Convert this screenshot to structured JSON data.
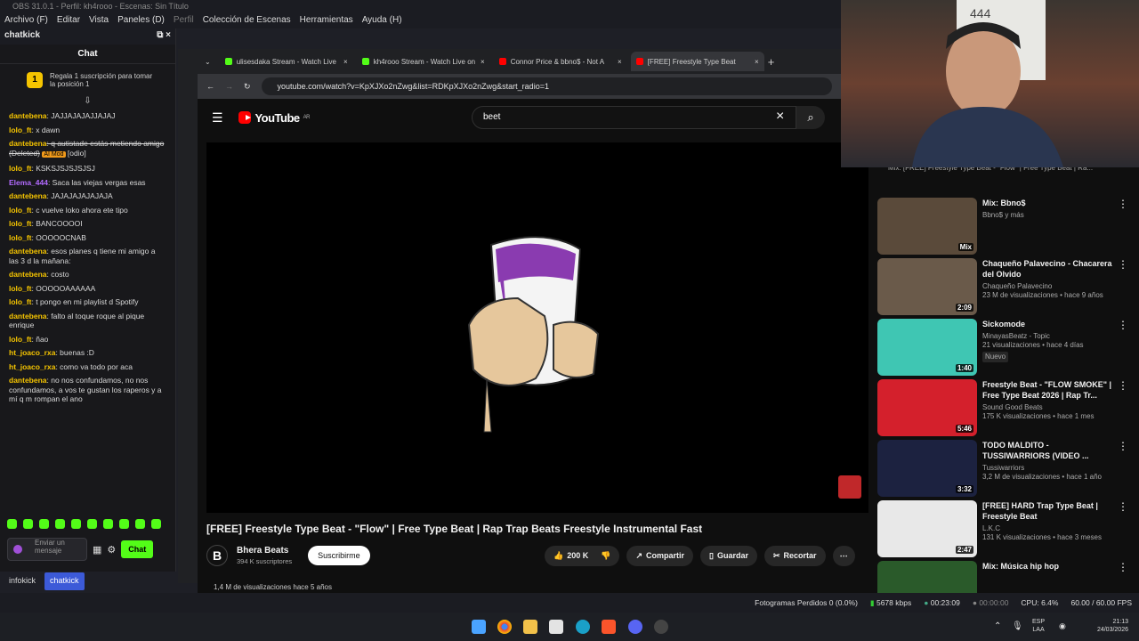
{
  "obs": {
    "title": "OBS 31.0.1 - Perfil: kh4rooo - Escenas: Sin Título",
    "menu": [
      "Archivo (F)",
      "Editar",
      "Vista",
      "Paneles (D)",
      "Perfil",
      "Colección de Escenas",
      "Herramientas",
      "Ayuda (H)"
    ],
    "dock_title": "chatkick",
    "dock_tabs": [
      "infokick",
      "chatkick"
    ],
    "status": {
      "frames": "Fotogramas Perdidos 0 (0.0%)",
      "bitrate": "5678 kbps",
      "live_time": "00:23:09",
      "rec_time": "00:00:00",
      "cpu": "CPU: 6.4%",
      "fps": "60.00 / 60.00 FPS"
    }
  },
  "chat": {
    "header": "Chat",
    "promo": "Regala 1 suscripción para tomar la posición 1",
    "messages": [
      {
        "user": "dantebena",
        "text": ": JAJJAJAJAJJAJAJ",
        "color": "#f5c400"
      },
      {
        "user": "lolo_ft",
        "text": ": x dawn",
        "color": "#f5c400"
      },
      {
        "user": "dantebena",
        "text": ": q autistade estás metiendo amigo (Deleted)",
        "color": "#f5c400",
        "mod": "AI Mod",
        "extra": "[odio]"
      },
      {
        "user": "lolo_ft",
        "text": ": KSKSJSJSJSJSJ",
        "color": "#f5c400"
      },
      {
        "user": "Elema_444",
        "text": ": Saca las viejas vergas esas",
        "color": "#b36bff"
      },
      {
        "user": "dantebena",
        "text": ": JAJAJAJAJAJAJA",
        "color": "#f5c400"
      },
      {
        "user": "lolo_ft",
        "text": ": c vuelve loko ahora ete tipo",
        "color": "#f5c400"
      },
      {
        "user": "lolo_ft",
        "text": ": BANCOOOOI",
        "color": "#f5c400"
      },
      {
        "user": "lolo_ft",
        "text": ": OOOOOCNAB",
        "color": "#f5c400"
      },
      {
        "user": "dantebena",
        "text": ": esos planes q tiene mi amigo a las 3 d la mañana:",
        "color": "#f5c400"
      },
      {
        "user": "dantebena",
        "text": ": costo",
        "color": "#f5c400"
      },
      {
        "user": "lolo_ft",
        "text": ": OOOOOAAAAAA",
        "color": "#f5c400"
      },
      {
        "user": "lolo_ft",
        "text": ": t pongo en mi playlist d Spotify",
        "color": "#f5c400"
      },
      {
        "user": "dantebena",
        "text": ": falto al toque roque al pique enrique",
        "color": "#f5c400"
      },
      {
        "user": "lolo_ft",
        "text": ": ñao",
        "color": "#f5c400"
      },
      {
        "user": "ht_joaco_rxa",
        "text": ": buenas :D",
        "color": "#f5c400"
      },
      {
        "user": "ht_joaco_rxa",
        "text": ": como va todo por aca",
        "color": "#f5c400"
      },
      {
        "user": "dantebena",
        "text": ": no nos confundamos, no nos confundamos, a vos te gustan los raperos y a mí q m rompan el ano",
        "color": "#f5c400"
      }
    ],
    "input_placeholder": "Enviar un mensaje",
    "send_label": "Chat"
  },
  "browser": {
    "tabs": [
      {
        "title": "ulisesdaka Stream - Watch Live",
        "fav": "#53fc18"
      },
      {
        "title": "kh4rooo Stream - Watch Live on",
        "fav": "#53fc18"
      },
      {
        "title": "Connor Price & bbno$ - Not A",
        "fav": "#ff0000"
      },
      {
        "title": "[FREE] Freestyle Type Beat",
        "fav": "#ff0000"
      }
    ],
    "url": "youtube.com/watch?v=KpXJXo2nZwg&list=RDKpXJXo2nZwg&start_radio=1"
  },
  "youtube": {
    "logo": "YouTube",
    "region": "AR",
    "search": "beet",
    "video_title": "[FREE] Freestyle Type Beat - \"Flow\" | Free Type Beat | Rap Trap Beats Freestyle Instrumental Fast",
    "channel": "Bhera Beats",
    "subs": "394 K suscriptores",
    "subscribe": "Suscribirme",
    "likes": "200 K",
    "share": "Compartir",
    "save": "Guardar",
    "clip": "Recortar",
    "views_line": "1,4 M de visualizaciones  hace 5 años",
    "related_top": "Mix: [FREE] Freestyle Type Beat - \"Flow\" | Free Type Beat | Ra...",
    "related": [
      {
        "title": "Mix: Bbno$",
        "channel": "Bbno$ y más",
        "meta": "",
        "dur": "Mix",
        "color": "#5a4a3a"
      },
      {
        "title": "Chaqueño Palavecino - Chacarera del Olvido",
        "channel": "Chaqueño Palavecino",
        "meta": "23 M de visualizaciones • hace 9 años",
        "dur": "2:09",
        "color": "#6a5a4a"
      },
      {
        "title": "Sickomode",
        "channel": "MinayasBeatz - Topic",
        "meta": "21 visualizaciones • hace 4 días",
        "dur": "1:40",
        "color": "#3fc6b3",
        "nuevo": "Nuevo"
      },
      {
        "title": "Freestyle Beat - \"FLOW SMOKE\" | Free Type Beat 2026 | Rap Tr...",
        "channel": "Sound Good Beats",
        "meta": "175 K visualizaciones • hace 1 mes",
        "dur": "5:46",
        "color": "#d4202c"
      },
      {
        "title": "TODO MALDITO - TUSSIWARRIORS (VIDEO ...",
        "channel": "Tussiwarriors",
        "meta": "3,2 M de visualizaciones • hace 1 año",
        "dur": "3:32",
        "color": "#1c2240"
      },
      {
        "title": "[FREE] HARD Trap Type Beat | Freestyle Beat",
        "channel": "L.K.C",
        "meta": "131 K visualizaciones • hace 3 meses",
        "dur": "2:47",
        "color": "#e8e8e8"
      },
      {
        "title": "Mix: Música hip hop",
        "channel": "",
        "meta": "",
        "dur": "",
        "color": "#2a5a2a"
      }
    ]
  },
  "taskbar": {
    "lang": "ESP",
    "lang2": "LAA",
    "time": "21:13",
    "date": "24/03/2026"
  }
}
